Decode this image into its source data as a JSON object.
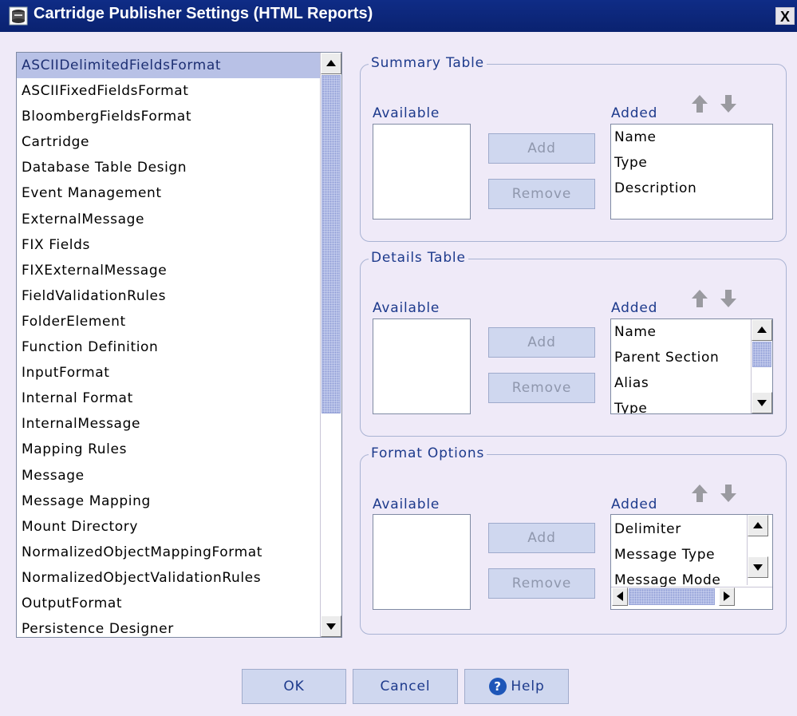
{
  "window": {
    "title": "Cartridge Publisher Settings (HTML Reports)",
    "close_label": "X"
  },
  "left_list": {
    "items": [
      "ASCIIDelimitedFieldsFormat",
      "ASCIIFixedFieldsFormat",
      "BloombergFieldsFormat",
      "Cartridge",
      "Database Table Design",
      "Event Management",
      "ExternalMessage",
      "FIX Fields",
      "FIXExternalMessage",
      "FieldValidationRules",
      "FolderElement",
      "Function Definition",
      "InputFormat",
      "Internal Format",
      "InternalMessage",
      "Mapping Rules",
      "Message",
      "Message Mapping",
      "Mount Directory",
      "NormalizedObjectMappingFormat",
      "NormalizedObjectValidationRules",
      "OutputFormat",
      "Persistence Designer"
    ],
    "selected_index": 0
  },
  "summary_table": {
    "legend": "Summary Table",
    "available_label": "Available",
    "added_label": "Added",
    "add_button": "Add",
    "remove_button": "Remove",
    "added_items": [
      "Name",
      "Type",
      "Description"
    ]
  },
  "details_table": {
    "legend": "Details Table",
    "available_label": "Available",
    "added_label": "Added",
    "add_button": "Add",
    "remove_button": "Remove",
    "added_items": [
      "Name",
      "Parent Section",
      "Alias",
      "Type"
    ]
  },
  "format_options": {
    "legend": "Format Options",
    "available_label": "Available",
    "added_label": "Added",
    "add_button": "Add",
    "remove_button": "Remove",
    "added_items": [
      "Delimiter",
      "Message Type",
      "Message Mode"
    ]
  },
  "footer": {
    "ok": "OK",
    "cancel": "Cancel",
    "help": "Help"
  },
  "colors": {
    "titlebar": "#0f2c86",
    "background": "#efeaf8",
    "selection": "#b8c1e6",
    "label_text": "#1d3a8c",
    "button_fill": "#cfd7ef"
  }
}
